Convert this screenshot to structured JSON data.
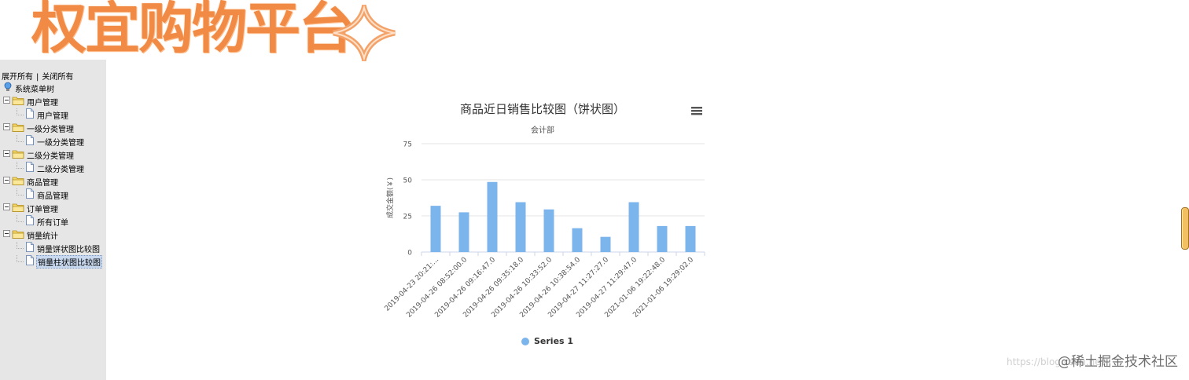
{
  "header": {
    "logo_text": "权宜购物平台"
  },
  "sidebar": {
    "expand_all": "展开所有",
    "separator": "|",
    "collapse_all": "关闭所有",
    "root": "系统菜单树",
    "groups": [
      {
        "label": "用户管理",
        "children": [
          "用户管理"
        ]
      },
      {
        "label": "一级分类管理",
        "children": [
          "一级分类管理"
        ]
      },
      {
        "label": "二级分类管理",
        "children": [
          "二级分类管理"
        ]
      },
      {
        "label": "商品管理",
        "children": [
          "商品管理"
        ]
      },
      {
        "label": "订单管理",
        "children": [
          "所有订单"
        ]
      },
      {
        "label": "销量统计",
        "children": [
          "销量饼状图比较图",
          "销量柱状图比较图"
        ]
      }
    ],
    "selected": "销量柱状图比较图"
  },
  "chart_data": {
    "type": "bar",
    "title": "商品近日销售比较图（饼状图）",
    "subtitle": "会计部",
    "ylabel": "成交金额(￥)",
    "xlabel": "",
    "ylim": [
      0,
      75
    ],
    "yticks": [
      "0",
      "25",
      "50",
      "75"
    ],
    "categories": [
      "2019-04-23 20:21:...",
      "2019-04-26 08:52:00.0",
      "2019-04-26 09:16:47.0",
      "2019-04-26 09:35:18.0",
      "2019-04-26 10:33:52.0",
      "2019-04-26 10:38:54.0",
      "2019-04-27 11:27:27.0",
      "2019-04-27 11:29:47.0",
      "2021-01-06 19:22:48.0",
      "2021-01-06 19:29:02.0"
    ],
    "series": [
      {
        "name": "Series 1",
        "values": [
          32,
          27.5,
          48.5,
          34.5,
          29.5,
          16.5,
          10.5,
          34.5,
          18,
          18
        ]
      }
    ],
    "grid": true,
    "legend_position": "bottom-center",
    "color": "#7cb5ec"
  },
  "watermark": {
    "text": "@稀土掘金技术社区",
    "faint": "https://blog.csdn.net"
  }
}
